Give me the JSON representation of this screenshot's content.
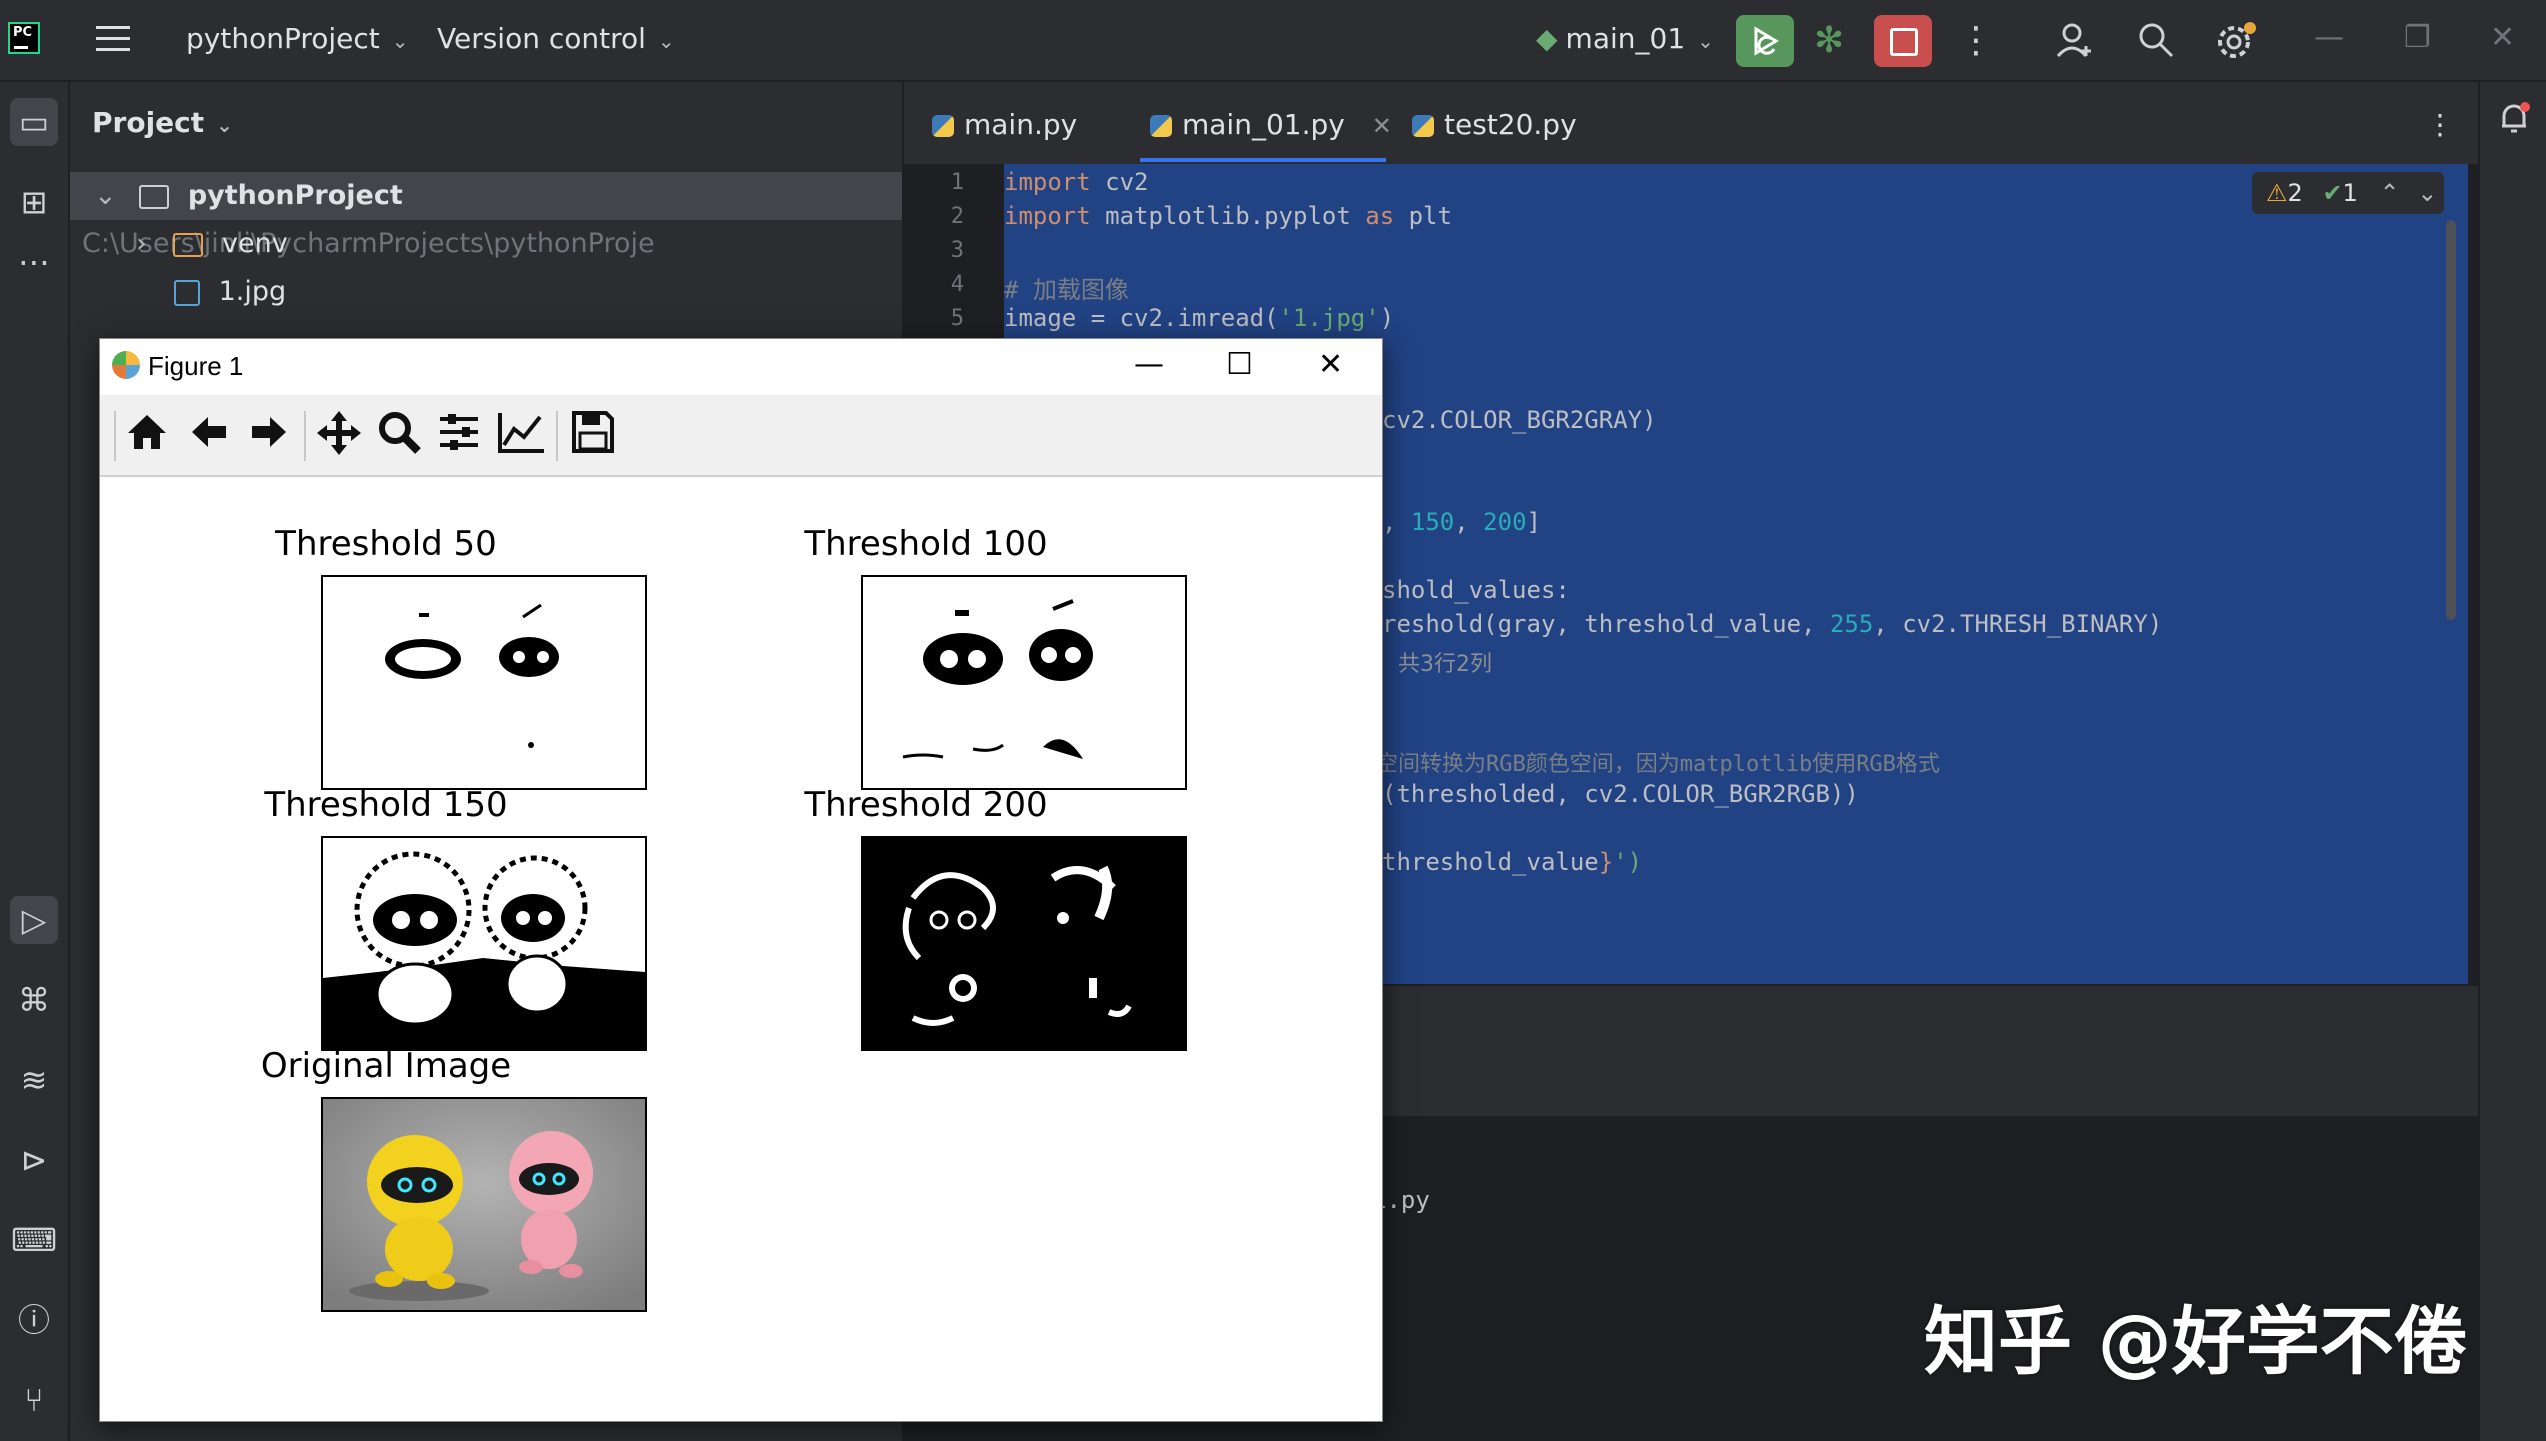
{
  "topbar": {
    "project_menu": "pythonProject",
    "vcs_menu": "Version control",
    "run_config": "main_01"
  },
  "project": {
    "title": "Project",
    "root_name": "pythonProject",
    "root_path": "C:\\Users\\jinli\\PycharmProjects\\pythonProje",
    "items": [
      {
        "label": "venv",
        "type": "folder"
      },
      {
        "label": "1.jpg",
        "type": "image"
      }
    ]
  },
  "editor": {
    "tabs": [
      {
        "label": "main.py",
        "active": false
      },
      {
        "label": "main_01.py",
        "active": true
      },
      {
        "label": "test20.py",
        "active": false
      }
    ],
    "line_numbers": [
      "1",
      "2",
      "3",
      "4",
      "5"
    ],
    "warnings": "2",
    "weak_warnings": "1",
    "lines": {
      "l1_kw": "import",
      "l1_rest": " cv2",
      "l2_kw": "import",
      "l2_mid": " matplotlib.pyplot ",
      "l2_as": "as",
      "l2_rest": " plt",
      "l4": "# 加载图像",
      "l5_pre": "image = cv2.imread(",
      "l5_str": "'1.jpg'",
      "l5_post": ")",
      "l8": "cv2.COLOR_BGR2GRAY)",
      "l11_pre": ", ",
      "l11_n1": "150",
      "l11_sep": ", ",
      "l11_n2": "200",
      "l11_post": "]",
      "l13": "shold_values:",
      "l14_pre": "reshold(gray, threshold_value, ",
      "l14_num": "255",
      "l14_post": ", cv2.THRESH_BINARY)",
      "l15_inlay": "共3行2列",
      "l18": "空间转换为RGB颜色空间，因为matplotlib使用RGB格式",
      "l19": "(thresholded, cv2.COLOR_BGR2RGB))",
      "l21_pre": "threshold_value",
      "l21_brace": "}",
      "l21_post": "')",
      "console_tail": "1.py"
    }
  },
  "figure": {
    "title": "Figure 1",
    "plots": [
      {
        "title": "Threshold 50"
      },
      {
        "title": "Threshold 100"
      },
      {
        "title": "Threshold 150"
      },
      {
        "title": "Threshold 200"
      },
      {
        "title": "Original Image"
      }
    ]
  },
  "watermark": "知乎 @好学不倦",
  "colors": {
    "run_green": "#57965c",
    "stop_red": "#c94f4f",
    "selection_blue": "#214283",
    "ide_bg": "#2b2d30"
  }
}
